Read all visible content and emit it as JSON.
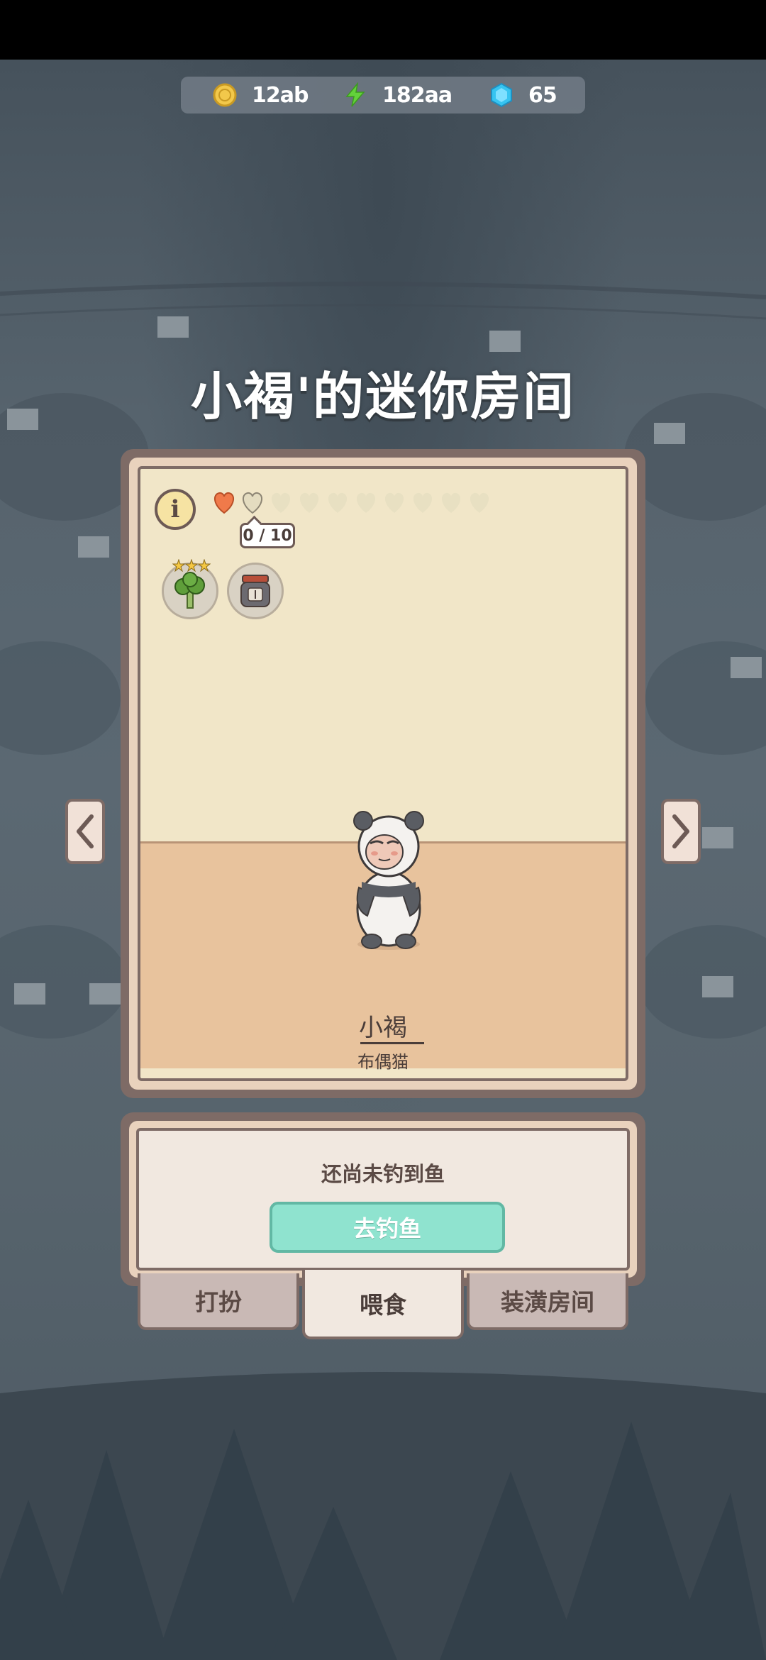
{
  "currencies": {
    "coins": "12ab",
    "energy": "182aa",
    "gems": "65"
  },
  "room": {
    "title": "小褐'的迷你房间",
    "love_progress": "0 / 10",
    "love_hearts_total": 10,
    "love_hearts_filled": 1,
    "pet_name": "小褐",
    "pet_breed": "布偶猫"
  },
  "feed_panel": {
    "message": "还尚未钓到鱼",
    "go_fish_label": "去钓鱼"
  },
  "tabs": {
    "dress_up": "打扮",
    "feed": "喂食",
    "decorate": "装潢房间"
  },
  "colors": {
    "heart_filled": "#f07a4a",
    "button_teal": "#8fe3cf",
    "frame_brown": "#7e6b66"
  }
}
